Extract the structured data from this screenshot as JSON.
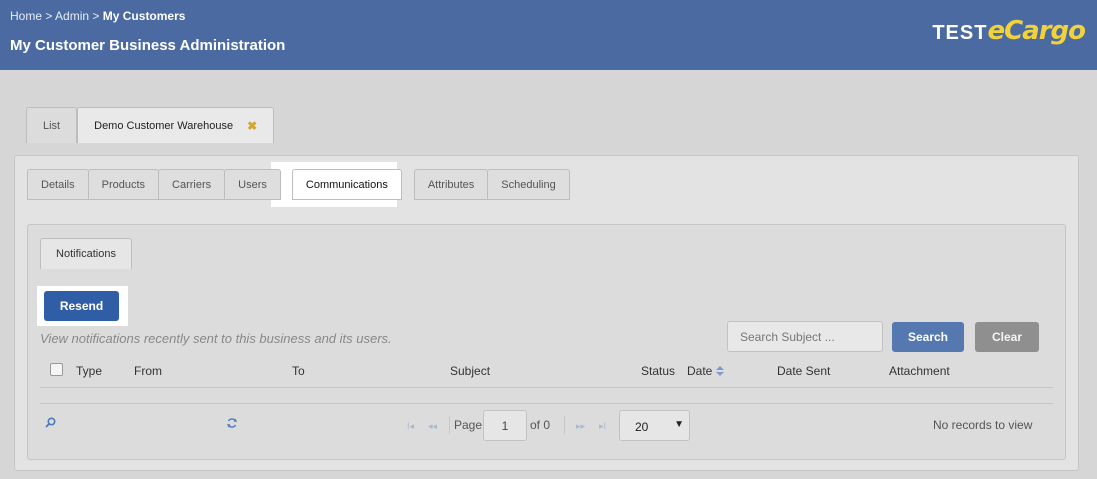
{
  "header": {
    "breadcrumb": {
      "home": "Home",
      "admin": "Admin",
      "current": "My Customers",
      "separator": ">"
    },
    "title": "My Customer Business Administration",
    "logo": {
      "part1": "TEST",
      "part2": "eCargo"
    }
  },
  "top_tabs": [
    {
      "label": "List"
    },
    {
      "label": "Demo Customer Warehouse",
      "close": "✖"
    }
  ],
  "sub_tabs": [
    {
      "label": "Details"
    },
    {
      "label": "Products"
    },
    {
      "label": "Carriers"
    },
    {
      "label": "Users"
    },
    {
      "label": "Communications",
      "active": true
    },
    {
      "label": "Attributes"
    },
    {
      "label": "Scheduling"
    }
  ],
  "notifications": {
    "tab_label": "Notifications",
    "resend_label": "Resend",
    "description": "View notifications recently sent to this business and its users.",
    "search_placeholder": "Search Subject ...",
    "search_label": "Search",
    "clear_label": "Clear"
  },
  "grid": {
    "columns": [
      "Type",
      "From",
      "To",
      "Subject",
      "Status",
      "Date",
      "Date Sent",
      "Attachment"
    ],
    "sorted_column": "Date"
  },
  "pager": {
    "page_label": "Page",
    "page_value": "1",
    "of_label": "of 0",
    "page_size": "20",
    "records_text": "No records to view"
  },
  "colors": {
    "header_bg": "#4a6aa1",
    "primary_button": "#2f5ea6",
    "search_button": "#5578b0",
    "clear_button": "#8f8f8f",
    "logo_accent": "#f2d23a"
  }
}
